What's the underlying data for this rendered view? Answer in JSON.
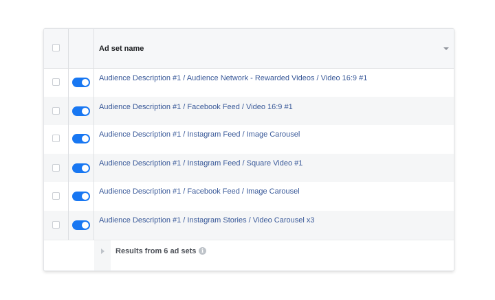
{
  "table": {
    "header": {
      "column_title": "Ad set name"
    },
    "rows": [
      {
        "name": "Audience Description #1 / Audience Network - Rewarded Videos / Video 16:9 #1",
        "enabled": true
      },
      {
        "name": "Audience Description #1 / Facebook Feed / Video 16:9 #1",
        "enabled": true
      },
      {
        "name": "Audience Description #1 / Instagram Feed / Image Carousel",
        "enabled": true
      },
      {
        "name": "Audience Description #1 / Instagram Feed / Square Video #1",
        "enabled": true
      },
      {
        "name": "Audience Description #1 / Facebook Feed / Image Carousel",
        "enabled": true
      },
      {
        "name": "Audience Description #1 / Instagram Stories / Video Carousel x3",
        "enabled": true
      }
    ],
    "footer": {
      "summary": "Results from 6 ad sets",
      "info_icon": "i"
    }
  },
  "colors": {
    "toggle_on": "#1877f2",
    "link": "#385898"
  }
}
